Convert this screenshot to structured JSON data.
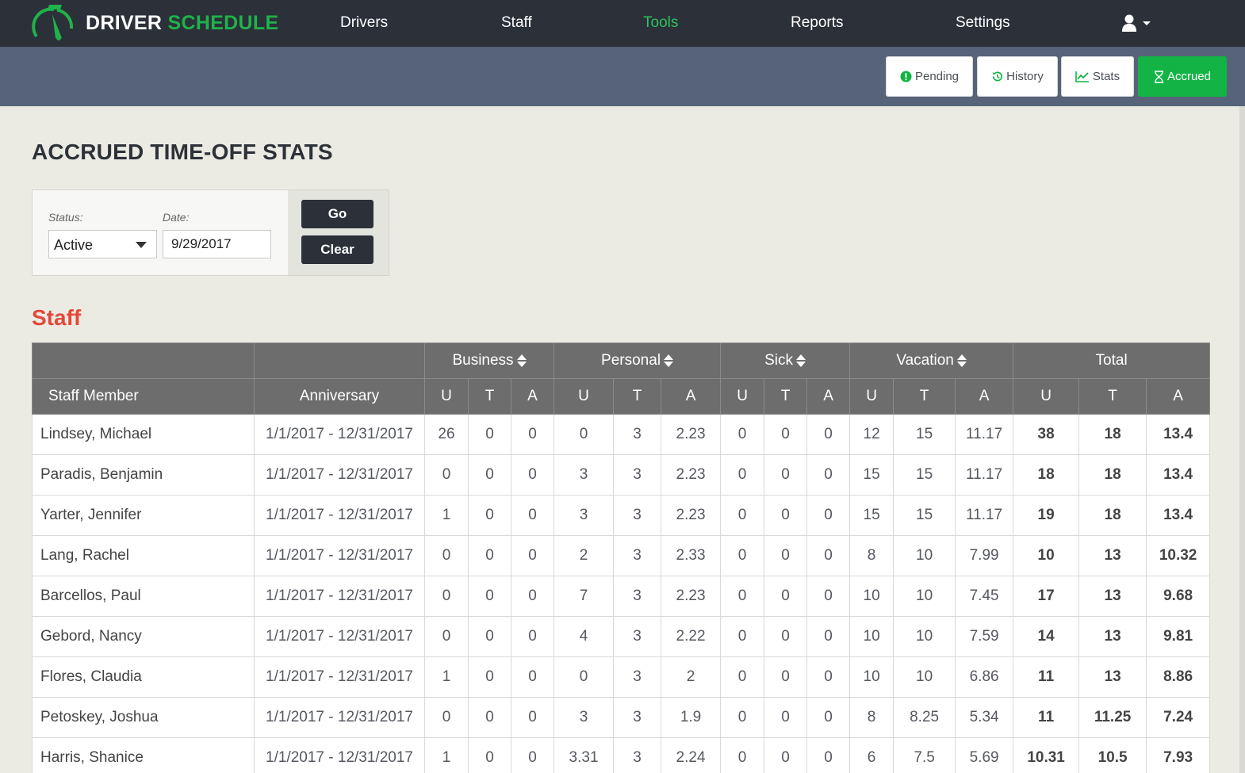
{
  "app": {
    "logo_word1": "DRIVER",
    "logo_word2": "SCHEDULE",
    "accent_color": "#1fb24a"
  },
  "nav": {
    "items": [
      {
        "label": "Drivers",
        "active": false
      },
      {
        "label": "Staff",
        "active": false
      },
      {
        "label": "Tools",
        "active": true
      },
      {
        "label": "Reports",
        "active": false
      },
      {
        "label": "Settings",
        "active": false
      }
    ],
    "user_icon": "user-icon"
  },
  "subnav": {
    "buttons": [
      {
        "label": "Pending",
        "icon": "exclamation-circle-icon",
        "active": false
      },
      {
        "label": "History",
        "icon": "history-icon",
        "active": false
      },
      {
        "label": "Stats",
        "icon": "line-chart-icon",
        "active": false
      },
      {
        "label": "Accrued",
        "icon": "hourglass-icon",
        "active": true
      }
    ]
  },
  "page": {
    "title": "ACCRUED TIME-OFF STATS",
    "section_title": "Staff"
  },
  "filter": {
    "status_label": "Status:",
    "status_value": "Active",
    "date_label": "Date:",
    "date_value": "9/29/2017",
    "go_label": "Go",
    "clear_label": "Clear"
  },
  "table": {
    "group_headers": [
      "Business",
      "Personal",
      "Sick",
      "Vacation",
      "Total"
    ],
    "col_staff": "Staff Member",
    "col_anniversary": "Anniversary",
    "sub_headers": [
      "U",
      "T",
      "A"
    ],
    "rows": [
      {
        "name": "Lindsey, Michael",
        "anniversary": "1/1/2017 - 12/31/2017",
        "values": [
          "26",
          "0",
          "0",
          "0",
          "3",
          "2.23",
          "0",
          "0",
          "0",
          "12",
          "15",
          "11.17",
          "38",
          "18",
          "13.4"
        ]
      },
      {
        "name": "Paradis, Benjamin",
        "anniversary": "1/1/2017 - 12/31/2017",
        "values": [
          "0",
          "0",
          "0",
          "3",
          "3",
          "2.23",
          "0",
          "0",
          "0",
          "15",
          "15",
          "11.17",
          "18",
          "18",
          "13.4"
        ]
      },
      {
        "name": "Yarter, Jennifer",
        "anniversary": "1/1/2017 - 12/31/2017",
        "values": [
          "1",
          "0",
          "0",
          "3",
          "3",
          "2.23",
          "0",
          "0",
          "0",
          "15",
          "15",
          "11.17",
          "19",
          "18",
          "13.4"
        ]
      },
      {
        "name": "Lang, Rachel",
        "anniversary": "1/1/2017 - 12/31/2017",
        "values": [
          "0",
          "0",
          "0",
          "2",
          "3",
          "2.33",
          "0",
          "0",
          "0",
          "8",
          "10",
          "7.99",
          "10",
          "13",
          "10.32"
        ]
      },
      {
        "name": "Barcellos, Paul",
        "anniversary": "1/1/2017 - 12/31/2017",
        "values": [
          "0",
          "0",
          "0",
          "7",
          "3",
          "2.23",
          "0",
          "0",
          "0",
          "10",
          "10",
          "7.45",
          "17",
          "13",
          "9.68"
        ]
      },
      {
        "name": "Gebord, Nancy",
        "anniversary": "1/1/2017 - 12/31/2017",
        "values": [
          "0",
          "0",
          "0",
          "4",
          "3",
          "2.22",
          "0",
          "0",
          "0",
          "10",
          "10",
          "7.59",
          "14",
          "13",
          "9.81"
        ]
      },
      {
        "name": "Flores, Claudia",
        "anniversary": "1/1/2017 - 12/31/2017",
        "values": [
          "1",
          "0",
          "0",
          "0",
          "3",
          "2",
          "0",
          "0",
          "0",
          "10",
          "10",
          "6.86",
          "11",
          "13",
          "8.86"
        ]
      },
      {
        "name": "Petoskey, Joshua",
        "anniversary": "1/1/2017 - 12/31/2017",
        "values": [
          "0",
          "0",
          "0",
          "3",
          "3",
          "1.9",
          "0",
          "0",
          "0",
          "8",
          "8.25",
          "5.34",
          "11",
          "11.25",
          "7.24"
        ]
      },
      {
        "name": "Harris, Shanice",
        "anniversary": "1/1/2017 - 12/31/2017",
        "values": [
          "1",
          "0",
          "0",
          "3.31",
          "3",
          "2.24",
          "0",
          "0",
          "0",
          "6",
          "7.5",
          "5.69",
          "10.31",
          "10.5",
          "7.93"
        ]
      }
    ]
  }
}
